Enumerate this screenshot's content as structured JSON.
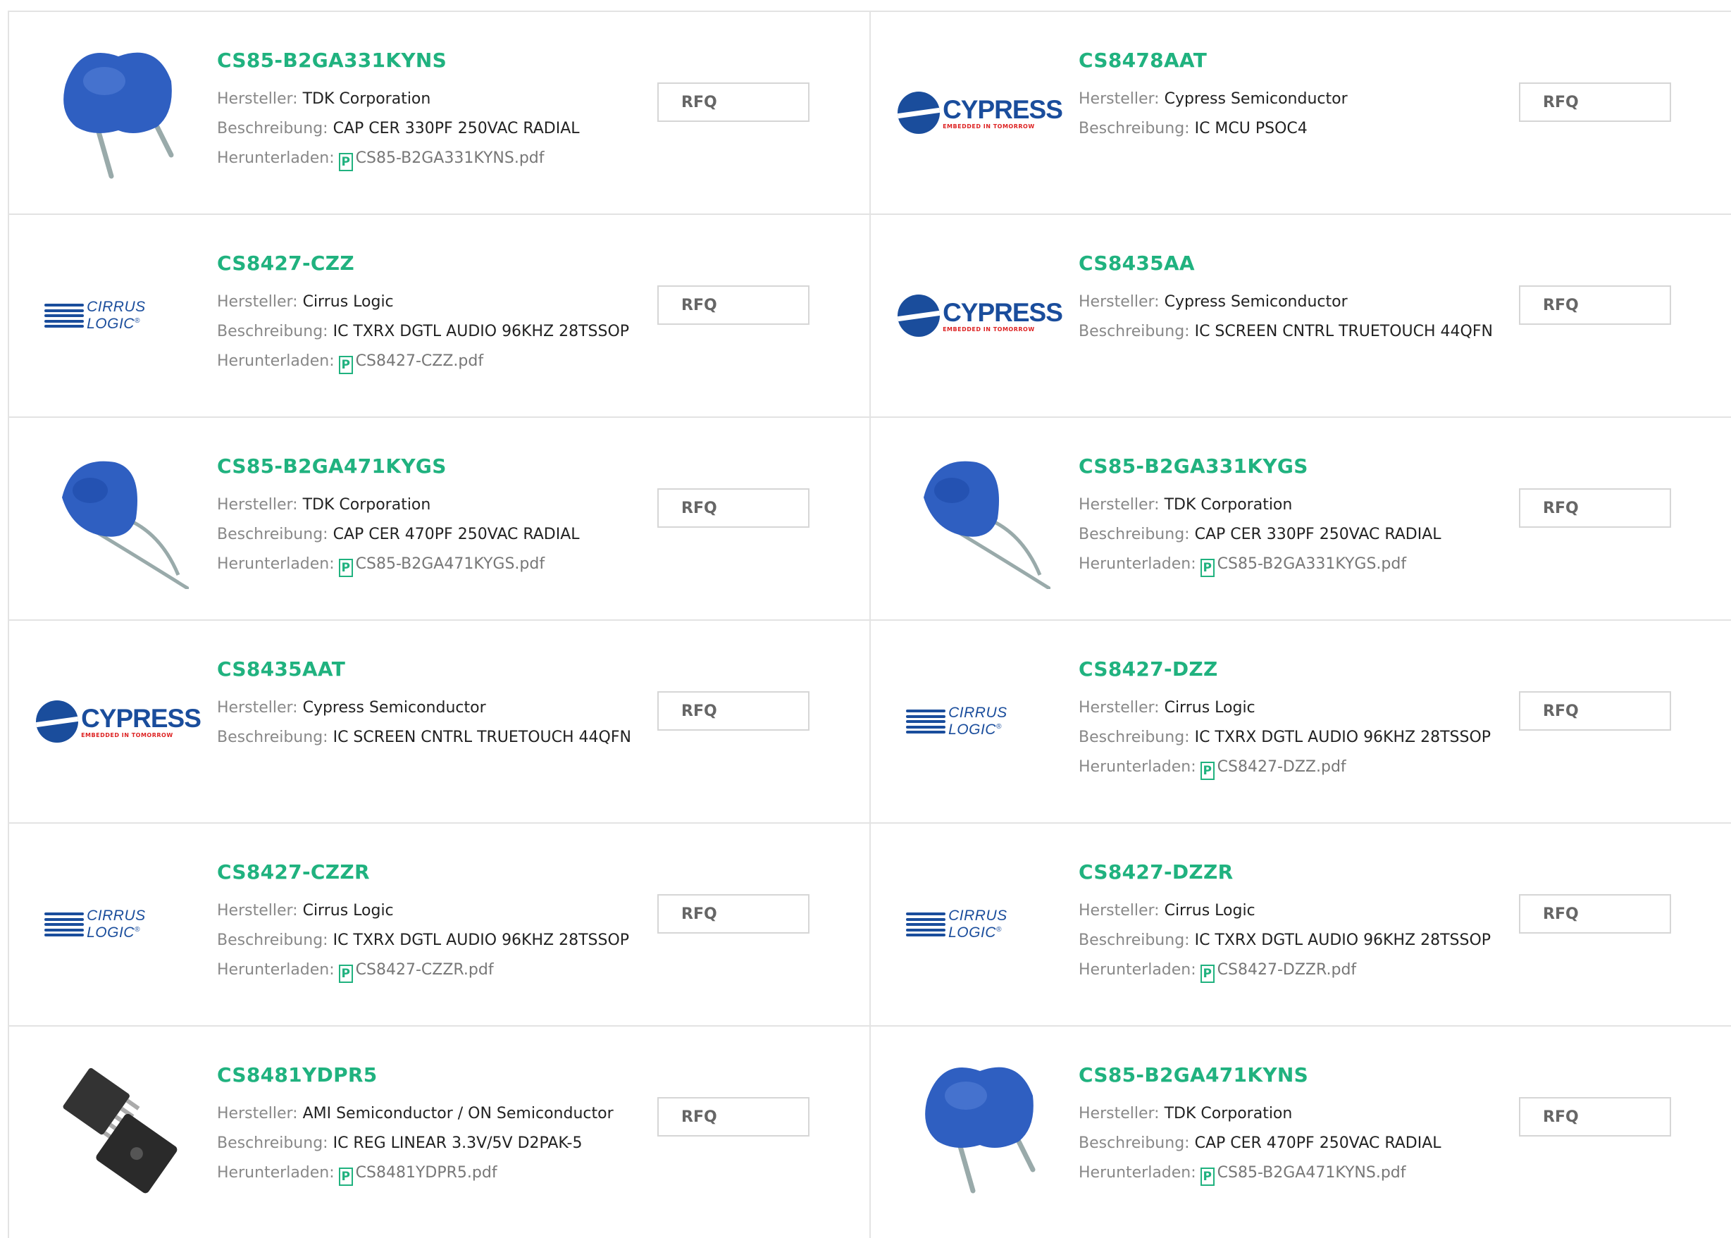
{
  "labels": {
    "manufacturer": "Hersteller:",
    "description": "Beschreibung:",
    "download": "Herunterladen:",
    "rfq": "RFQ",
    "pdf_icon": "P"
  },
  "logos": {
    "cypress_word": "CYPRESS",
    "cypress_tagline": "EMBEDDED IN TOMORROW",
    "cirrus_word": "CIRRUS LOGIC",
    "cirrus_mark": "®"
  },
  "colors": {
    "accent": "#20b27f",
    "brand_blue": "#1a4d9c",
    "capacitor_blue": "#2f5fc1"
  },
  "products": [
    {
      "pn": "CS85-B2GA331KYNS",
      "mfr": "TDK Corporation",
      "desc": "CAP CER 330PF 250VAC RADIAL",
      "pdf": "CS85-B2GA331KYNS.pdf",
      "image": "capacitor-front"
    },
    {
      "pn": "CS8478AAT",
      "mfr": "Cypress Semiconductor",
      "desc": "IC MCU PSOC4",
      "pdf": "",
      "image": "cypress-logo"
    },
    {
      "pn": "CS8427-CZZ",
      "mfr": "Cirrus Logic",
      "desc": "IC TXRX DGTL AUDIO 96KHZ 28TSSOP",
      "pdf": "CS8427-CZZ.pdf",
      "image": "cirrus-logo"
    },
    {
      "pn": "CS8435AA",
      "mfr": "Cypress Semiconductor",
      "desc": "IC SCREEN CNTRL TRUETOUCH 44QFN",
      "pdf": "",
      "image": "cypress-logo"
    },
    {
      "pn": "CS85-B2GA471KYGS",
      "mfr": "TDK Corporation",
      "desc": "CAP CER 470PF 250VAC RADIAL",
      "pdf": "CS85-B2GA471KYGS.pdf",
      "image": "capacitor-side"
    },
    {
      "pn": "CS85-B2GA331KYGS",
      "mfr": "TDK Corporation",
      "desc": "CAP CER 330PF 250VAC RADIAL",
      "pdf": "CS85-B2GA331KYGS.pdf",
      "image": "capacitor-side"
    },
    {
      "pn": "CS8435AAT",
      "mfr": "Cypress Semiconductor",
      "desc": "IC SCREEN CNTRL TRUETOUCH 44QFN",
      "pdf": "",
      "image": "cypress-logo"
    },
    {
      "pn": "CS8427-DZZ",
      "mfr": "Cirrus Logic",
      "desc": "IC TXRX DGTL AUDIO 96KHZ 28TSSOP",
      "pdf": "CS8427-DZZ.pdf",
      "image": "cirrus-logo"
    },
    {
      "pn": "CS8427-CZZR",
      "mfr": "Cirrus Logic",
      "desc": "IC TXRX DGTL AUDIO 96KHZ 28TSSOP",
      "pdf": "CS8427-CZZR.pdf",
      "image": "cirrus-logo"
    },
    {
      "pn": "CS8427-DZZR",
      "mfr": "Cirrus Logic",
      "desc": "IC TXRX DGTL AUDIO 96KHZ 28TSSOP",
      "pdf": "CS8427-DZZR.pdf",
      "image": "cirrus-logo"
    },
    {
      "pn": "CS8481YDPR5",
      "mfr": "AMI Semiconductor / ON Semiconductor",
      "desc": "IC REG LINEAR 3.3V/5V D2PAK-5",
      "pdf": "CS8481YDPR5.pdf",
      "image": "d2pak-package"
    },
    {
      "pn": "CS85-B2GA471KYNS",
      "mfr": "TDK Corporation",
      "desc": "CAP CER 470PF 250VAC RADIAL",
      "pdf": "CS85-B2GA471KYNS.pdf",
      "image": "capacitor-front"
    }
  ]
}
